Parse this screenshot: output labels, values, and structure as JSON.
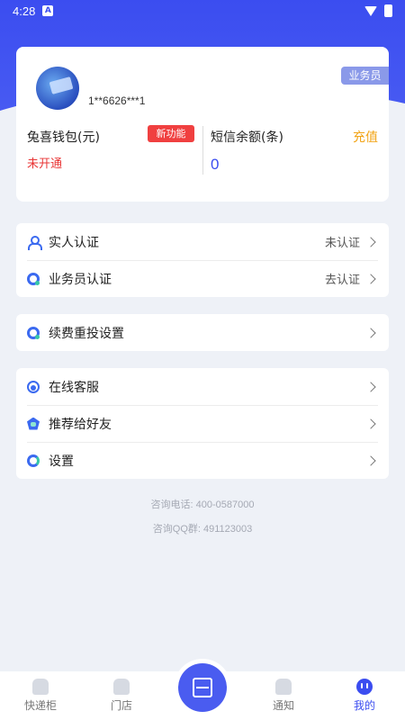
{
  "status_bar": {
    "time": "4:28",
    "notification_icon": "A"
  },
  "profile": {
    "phone": "1**6626***1",
    "role_badge": "业务员",
    "wallet": {
      "title": "兔喜钱包(元)",
      "badge": "新功能",
      "status": "未开通"
    },
    "sms": {
      "title": "短信余额(条)",
      "action": "充值",
      "value": "0"
    }
  },
  "verification": {
    "items": [
      {
        "label": "实人认证",
        "value": "未认证",
        "icon": "person-icon"
      },
      {
        "label": "业务员认证",
        "value": "去认证",
        "icon": "verify-icon"
      }
    ]
  },
  "renewal": {
    "label": "续费重投设置",
    "icon": "renewal-icon"
  },
  "misc": {
    "items": [
      {
        "label": "在线客服",
        "icon": "customer-service-icon"
      },
      {
        "label": "推荐给好友",
        "icon": "share-icon"
      },
      {
        "label": "设置",
        "icon": "settings-icon"
      }
    ]
  },
  "contact": {
    "phone": "咨询电话: 400-0587000",
    "qq": "咨询QQ群: 491123003"
  },
  "tabbar": {
    "tabs": [
      {
        "label": "快递柜"
      },
      {
        "label": "门店"
      },
      {
        "label": ""
      },
      {
        "label": "通知"
      },
      {
        "label": "我的"
      }
    ],
    "active_color": "#3b4df0"
  }
}
